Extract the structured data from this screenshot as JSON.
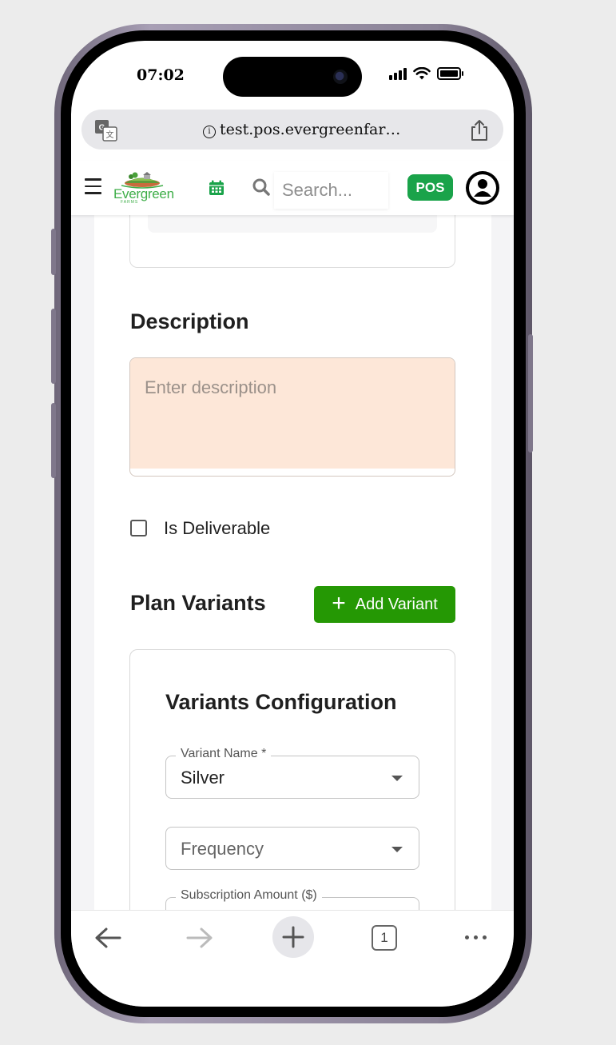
{
  "status_bar": {
    "time": "07:02",
    "icons": [
      "cellular-signal-icon",
      "wifi-icon",
      "battery-icon"
    ]
  },
  "browser": {
    "url": "test.pos.evergreenfar…",
    "icons": [
      "translate-icon",
      "info-icon",
      "share-icon"
    ]
  },
  "app_header": {
    "logo_text": "Evergreen",
    "logo_subtext": "FARMS",
    "search_placeholder": "Search...",
    "pos_label": "POS",
    "icons": [
      "menu-icon",
      "calendar-icon",
      "search-icon",
      "user-avatar-icon"
    ],
    "brand_color": "#1aa34a"
  },
  "form": {
    "description_heading": "Description",
    "description_placeholder": "Enter description",
    "is_deliverable_label": "Is Deliverable",
    "is_deliverable_checked": false,
    "plan_variants_heading": "Plan Variants",
    "add_variant_label": "Add Variant",
    "add_variant_color": "#259804",
    "variants_config": {
      "heading": "Variants Configuration",
      "variant_name_label": "Variant Name *",
      "variant_name_value": "Silver",
      "frequency_placeholder": "Frequency",
      "subscription_amount_label": "Subscription Amount ($)"
    }
  },
  "browser_toolbar": {
    "tab_count": "1",
    "icons": [
      "back-arrow-icon",
      "forward-arrow-icon",
      "new-tab-plus-icon",
      "tabs-icon",
      "more-icon"
    ]
  }
}
